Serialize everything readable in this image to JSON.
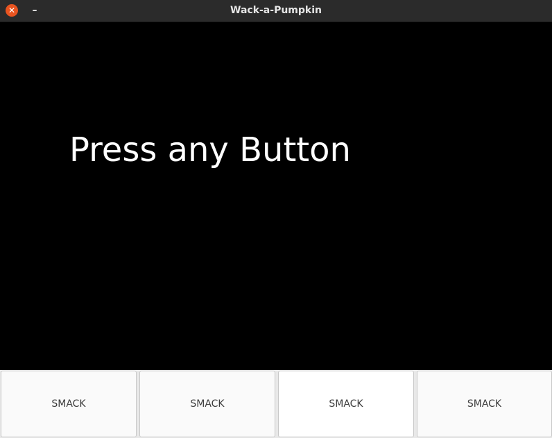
{
  "window": {
    "title": "Wack-a-Pumpkin",
    "close_glyph": "✕",
    "minimize_glyph": "–"
  },
  "game": {
    "message": "Press any Button"
  },
  "buttons": [
    {
      "label": "SMACK"
    },
    {
      "label": "SMACK"
    },
    {
      "label": "SMACK"
    },
    {
      "label": "SMACK"
    }
  ],
  "colors": {
    "close_button": "#e95420",
    "titlebar": "#2b2b2b",
    "canvas": "#000000",
    "message_text": "#ffffff"
  }
}
